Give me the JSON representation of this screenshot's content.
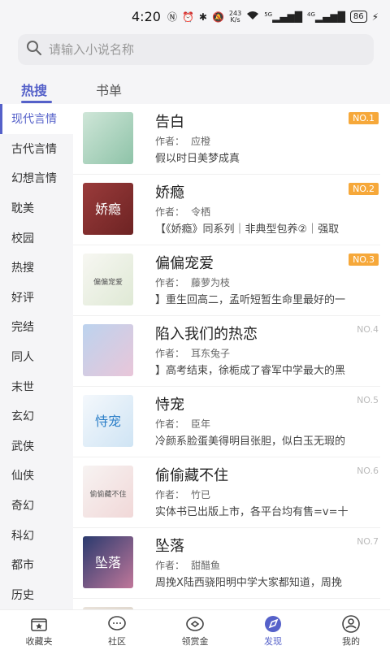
{
  "status_bar": {
    "time": "4:20",
    "net_speed_value": "243",
    "net_speed_unit": "K/s",
    "signal1": "5G",
    "signal2": "4G",
    "battery": "86"
  },
  "search": {
    "placeholder": "请输入小说名称"
  },
  "tabs": [
    {
      "label": "热搜",
      "active": true
    },
    {
      "label": "书单",
      "active": false
    }
  ],
  "categories": [
    {
      "label": "现代言情",
      "active": true
    },
    {
      "label": "古代言情"
    },
    {
      "label": "幻想言情"
    },
    {
      "label": "耽美"
    },
    {
      "label": "校园"
    },
    {
      "label": "热搜"
    },
    {
      "label": "好评"
    },
    {
      "label": "完结"
    },
    {
      "label": "同人"
    },
    {
      "label": "末世"
    },
    {
      "label": "玄幻"
    },
    {
      "label": "武侠"
    },
    {
      "label": "仙侠"
    },
    {
      "label": "奇幻"
    },
    {
      "label": "科幻"
    },
    {
      "label": "都市"
    },
    {
      "label": "历史"
    }
  ],
  "author_label": "作者：",
  "books": [
    {
      "title": "告白",
      "author": "应橙",
      "desc": "假以时日美梦成真",
      "rank": "NO.1",
      "cover_text": "",
      "cover_colors": [
        "#cfe6d8",
        "#8ec3a8"
      ]
    },
    {
      "title": "娇瘾",
      "author": "令栖",
      "desc": "【《娇瘾》同系列｜非典型包养②｜强取",
      "rank": "NO.2",
      "cover_text": "娇瘾",
      "cover_colors": [
        "#9a3b3b",
        "#6d2323"
      ]
    },
    {
      "title": "偏偏宠爱",
      "author": "藤萝为枝",
      "desc": "】重生回高二，孟听短暂生命里最好的一",
      "rank": "NO.3",
      "cover_text": "偏偏宠爱",
      "cover_colors": [
        "#f7f7f2",
        "#dfe9d5"
      ]
    },
    {
      "title": "陷入我们的热恋",
      "author": "耳东兔子",
      "desc": "】高考结束，徐栀成了睿军中学最大的黑",
      "rank": "NO.4",
      "cover_text": "",
      "cover_colors": [
        "#bcd3ee",
        "#e9c6d9"
      ]
    },
    {
      "title": "恃宠",
      "author": "臣年",
      "desc": "冷颜系脸蛋美得明目张胆，似白玉无瑕的",
      "rank": "NO.5",
      "cover_text": "恃宠",
      "cover_colors": [
        "#f4f8fc",
        "#cfe4f4"
      ]
    },
    {
      "title": "偷偷藏不住",
      "author": "竹已",
      "desc": "实体书已出版上市，各平台均有售=v=十",
      "rank": "NO.6",
      "cover_text": "偷偷藏不住",
      "cover_colors": [
        "#f7f3f2",
        "#f1d8d8"
      ]
    },
    {
      "title": "坠落",
      "author": "甜醋鱼",
      "desc": "周挽X陆西骁阳明中学大家都知道，周挽",
      "rank": "NO.7",
      "cover_text": "坠落",
      "cover_colors": [
        "#2a3a6e",
        "#c0779a"
      ]
    },
    {
      "title": "",
      "author": "",
      "desc": "",
      "rank": "",
      "cover_text": "",
      "cover_colors": [
        "#e9e2da",
        "#d8cfc4"
      ]
    }
  ],
  "bottom_nav": [
    {
      "label": "收藏夹",
      "icon": "bookshelf-icon"
    },
    {
      "label": "社区",
      "icon": "chat-bubble-icon"
    },
    {
      "label": "领赏金",
      "icon": "reward-icon"
    },
    {
      "label": "发现",
      "icon": "discover-icon",
      "active": true
    },
    {
      "label": "我的",
      "icon": "profile-icon"
    }
  ],
  "colors": {
    "accent": "#5561c9",
    "rank_badge": "#f6a83a",
    "background": "#f5f5f7"
  }
}
